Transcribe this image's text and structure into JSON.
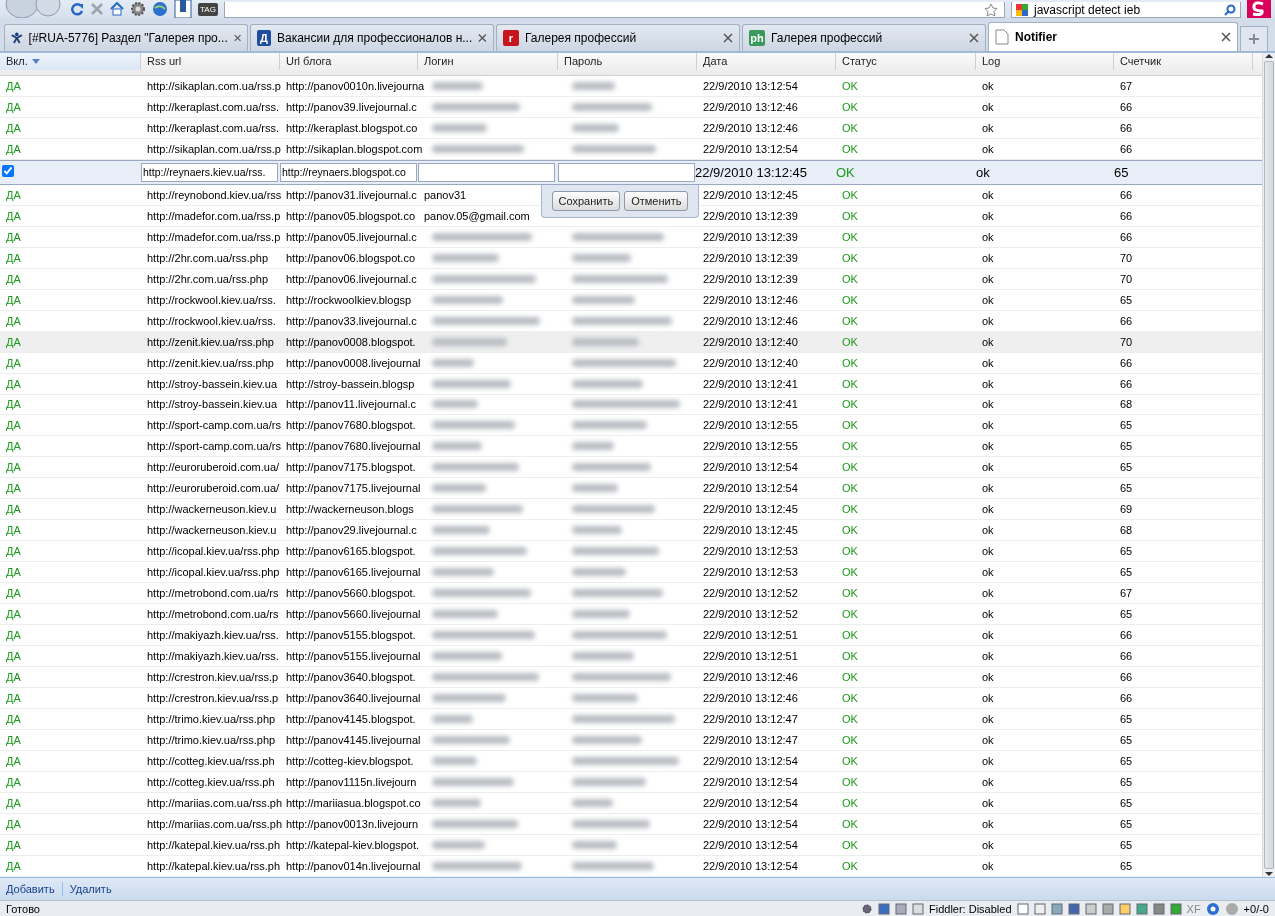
{
  "browser": {
    "search_query": "javascript detect ieb",
    "tag_label": "TAG"
  },
  "tabs": [
    {
      "label": "[#RUA-5776] Раздел \"Галерея про...",
      "selected": false,
      "kind": "figure"
    },
    {
      "label": "Вакансии для профессионалов н...",
      "selected": false,
      "kind": "letter",
      "icon_text": "Д"
    },
    {
      "label": "Галерея профессий",
      "selected": false,
      "kind": "letter",
      "icon_text": "r"
    },
    {
      "label": "Галерея профессий",
      "selected": false,
      "kind": "letter",
      "icon_text": "ph"
    },
    {
      "label": "Notifier",
      "selected": true,
      "kind": "page"
    }
  ],
  "grid": {
    "columns": [
      {
        "label": "Вкл.",
        "sorted": true
      },
      {
        "label": "Rss url",
        "sorted": false
      },
      {
        "label": "Url блога",
        "sorted": false
      },
      {
        "label": "Логин",
        "sorted": false
      },
      {
        "label": "Пароль",
        "sorted": false
      },
      {
        "label": "Дата",
        "sorted": false
      },
      {
        "label": "Статус",
        "sorted": false
      },
      {
        "label": "Log",
        "sorted": false
      },
      {
        "label": "Счетчик",
        "sorted": false
      }
    ],
    "rows": [
      {
        "kind": "view",
        "on": "ДА",
        "rss": "http://sikaplan.com.ua/rss.p",
        "blog": "http://panov0010n.livejourna",
        "login_blurred": true,
        "password_blurred": true,
        "date": "22/9/2010 13:12:54",
        "status": "OK",
        "log": "ok",
        "count": "67",
        "highlighted": false
      },
      {
        "kind": "view",
        "on": "ДА",
        "rss": "http://keraplast.com.ua/rss.",
        "blog": "http://panov39.livejournal.c",
        "login_blurred": true,
        "password_blurred": true,
        "date": "22/9/2010 13:12:46",
        "status": "OK",
        "log": "ok",
        "count": "66",
        "highlighted": false
      },
      {
        "kind": "view",
        "on": "ДА",
        "rss": "http://keraplast.com.ua/rss.",
        "blog": "http://keraplast.blogspot.co",
        "login_blurred": true,
        "password_blurred": true,
        "date": "22/9/2010 13:12:46",
        "status": "OK",
        "log": "ok",
        "count": "66",
        "highlighted": false
      },
      {
        "kind": "view",
        "on": "ДА",
        "rss": "http://sikaplan.com.ua/rss.p",
        "blog": "http://sikaplan.blogspot.com",
        "login_blurred": true,
        "password_blurred": true,
        "date": "22/9/2010 13:12:54",
        "status": "OK",
        "log": "ok",
        "count": "66",
        "highlighted": false
      },
      {
        "kind": "editor",
        "checked": true,
        "rss": "http://reynaers.kiev.ua/rss.",
        "blog": "http://reynaers.blogspot.co",
        "date": "22/9/2010 13:12:45",
        "status": "OK",
        "log": "ok",
        "count": "65"
      },
      {
        "kind": "view",
        "on": "ДА",
        "rss": "http://reynobond.kiev.ua/rss",
        "blog": "http://panov31.livejournal.c",
        "login": "panov31",
        "date": "22/9/2010 13:12:45",
        "status": "OK",
        "log": "ok",
        "count": "66",
        "highlighted": false
      },
      {
        "kind": "view",
        "on": "ДА",
        "rss": "http://madefor.com.ua/rss.p",
        "blog": "http://panov05.blogspot.co",
        "login": "panov.05@gmail.com",
        "date": "22/9/2010 13:12:39",
        "status": "OK",
        "log": "ok",
        "count": "66",
        "highlighted": false
      },
      {
        "kind": "view",
        "on": "ДА",
        "rss": "http://madefor.com.ua/rss.p",
        "blog": "http://panov05.livejournal.c",
        "login_blurred": true,
        "password_blurred": true,
        "date": "22/9/2010 13:12:39",
        "status": "OK",
        "log": "ok",
        "count": "66",
        "highlighted": false
      },
      {
        "kind": "view",
        "on": "ДА",
        "rss": "http://2hr.com.ua/rss.php",
        "blog": "http://panov06.blogspot.co",
        "login_blurred": true,
        "password_blurred": true,
        "date": "22/9/2010 13:12:39",
        "status": "OK",
        "log": "ok",
        "count": "70",
        "highlighted": false
      },
      {
        "kind": "view",
        "on": "ДА",
        "rss": "http://2hr.com.ua/rss.php",
        "blog": "http://panov06.livejournal.c",
        "login_blurred": true,
        "password_blurred": true,
        "date": "22/9/2010 13:12:39",
        "status": "OK",
        "log": "ok",
        "count": "70",
        "highlighted": false
      },
      {
        "kind": "view",
        "on": "ДА",
        "rss": "http://rockwool.kiev.ua/rss.",
        "blog": "http://rockwoolkiev.blogsp",
        "login_blurred": true,
        "password_blurred": true,
        "date": "22/9/2010 13:12:46",
        "status": "OK",
        "log": "ok",
        "count": "65",
        "highlighted": false
      },
      {
        "kind": "view",
        "on": "ДА",
        "rss": "http://rockwool.kiev.ua/rss.",
        "blog": "http://panov33.livejournal.c",
        "login_blurred": true,
        "password_blurred": true,
        "date": "22/9/2010 13:12:46",
        "status": "OK",
        "log": "ok",
        "count": "66",
        "highlighted": false
      },
      {
        "kind": "view",
        "on": "ДА",
        "rss": "http://zenit.kiev.ua/rss.php",
        "blog": "http://panov0008.blogspot.",
        "login_blurred": true,
        "password_blurred": true,
        "date": "22/9/2010 13:12:40",
        "status": "OK",
        "log": "ok",
        "count": "70",
        "highlighted": true
      },
      {
        "kind": "view",
        "on": "ДА",
        "rss": "http://zenit.kiev.ua/rss.php",
        "blog": "http://panov0008.livejournal",
        "login_blurred": true,
        "password_blurred": true,
        "date": "22/9/2010 13:12:40",
        "status": "OK",
        "log": "ok",
        "count": "66",
        "highlighted": false
      },
      {
        "kind": "view",
        "on": "ДА",
        "rss": "http://stroy-bassein.kiev.ua",
        "blog": "http://stroy-bassein.blogsp",
        "login_blurred": true,
        "password_blurred": true,
        "date": "22/9/2010 13:12:41",
        "status": "OK",
        "log": "ok",
        "count": "66",
        "highlighted": false
      },
      {
        "kind": "view",
        "on": "ДА",
        "rss": "http://stroy-bassein.kiev.ua",
        "blog": "http://panov11.livejournal.c",
        "login_blurred": true,
        "password_blurred": true,
        "date": "22/9/2010 13:12:41",
        "status": "OK",
        "log": "ok",
        "count": "68",
        "highlighted": false
      },
      {
        "kind": "view",
        "on": "ДА",
        "rss": "http://sport-camp.com.ua/rs",
        "blog": "http://panov7680.blogspot.",
        "login_blurred": true,
        "password_blurred": true,
        "date": "22/9/2010 13:12:55",
        "status": "OK",
        "log": "ok",
        "count": "65",
        "highlighted": false
      },
      {
        "kind": "view",
        "on": "ДА",
        "rss": "http://sport-camp.com.ua/rs",
        "blog": "http://panov7680.livejournal",
        "login_blurred": true,
        "password_blurred": true,
        "date": "22/9/2010 13:12:55",
        "status": "OK",
        "log": "ok",
        "count": "65",
        "highlighted": false
      },
      {
        "kind": "view",
        "on": "ДА",
        "rss": "http://euroruberoid.com.ua/",
        "blog": "http://panov7175.blogspot.",
        "login_blurred": true,
        "password_blurred": true,
        "date": "22/9/2010 13:12:54",
        "status": "OK",
        "log": "ok",
        "count": "65",
        "highlighted": false
      },
      {
        "kind": "view",
        "on": "ДА",
        "rss": "http://euroruberoid.com.ua/",
        "blog": "http://panov7175.livejournal",
        "login_blurred": true,
        "password_blurred": true,
        "date": "22/9/2010 13:12:54",
        "status": "OK",
        "log": "ok",
        "count": "65",
        "highlighted": false
      },
      {
        "kind": "view",
        "on": "ДА",
        "rss": "http://wackerneuson.kiev.u",
        "blog": "http://wackerneuson.blogs",
        "login_blurred": true,
        "password_blurred": true,
        "date": "22/9/2010 13:12:45",
        "status": "OK",
        "log": "ok",
        "count": "69",
        "highlighted": false
      },
      {
        "kind": "view",
        "on": "ДА",
        "rss": "http://wackerneuson.kiev.u",
        "blog": "http://panov29.livejournal.c",
        "login_blurred": true,
        "password_blurred": true,
        "date": "22/9/2010 13:12:45",
        "status": "OK",
        "log": "ok",
        "count": "68",
        "highlighted": false
      },
      {
        "kind": "view",
        "on": "ДА",
        "rss": "http://icopal.kiev.ua/rss.php",
        "blog": "http://panov6165.blogspot.",
        "login_blurred": true,
        "password_blurred": true,
        "date": "22/9/2010 13:12:53",
        "status": "OK",
        "log": "ok",
        "count": "65",
        "highlighted": false
      },
      {
        "kind": "view",
        "on": "ДА",
        "rss": "http://icopal.kiev.ua/rss.php",
        "blog": "http://panov6165.livejournal",
        "login_blurred": true,
        "password_blurred": true,
        "date": "22/9/2010 13:12:53",
        "status": "OK",
        "log": "ok",
        "count": "65",
        "highlighted": false
      },
      {
        "kind": "view",
        "on": "ДА",
        "rss": "http://metrobond.com.ua/rs",
        "blog": "http://panov5660.blogspot.",
        "login_blurred": true,
        "password_blurred": true,
        "date": "22/9/2010 13:12:52",
        "status": "OK",
        "log": "ok",
        "count": "67",
        "highlighted": false
      },
      {
        "kind": "view",
        "on": "ДА",
        "rss": "http://metrobond.com.ua/rs",
        "blog": "http://panov5660.livejournal",
        "login_blurred": true,
        "password_blurred": true,
        "date": "22/9/2010 13:12:52",
        "status": "OK",
        "log": "ok",
        "count": "65",
        "highlighted": false
      },
      {
        "kind": "view",
        "on": "ДА",
        "rss": "http://makiyazh.kiev.ua/rss.",
        "blog": "http://panov5155.blogspot.",
        "login_blurred": true,
        "password_blurred": true,
        "date": "22/9/2010 13:12:51",
        "status": "OK",
        "log": "ok",
        "count": "66",
        "highlighted": false
      },
      {
        "kind": "view",
        "on": "ДА",
        "rss": "http://makiyazh.kiev.ua/rss.",
        "blog": "http://panov5155.livejournal",
        "login_blurred": true,
        "password_blurred": true,
        "date": "22/9/2010 13:12:51",
        "status": "OK",
        "log": "ok",
        "count": "66",
        "highlighted": false
      },
      {
        "kind": "view",
        "on": "ДА",
        "rss": "http://crestron.kiev.ua/rss.p",
        "blog": "http://panov3640.blogspot.",
        "login_blurred": true,
        "password_blurred": true,
        "date": "22/9/2010 13:12:46",
        "status": "OK",
        "log": "ok",
        "count": "66",
        "highlighted": false
      },
      {
        "kind": "view",
        "on": "ДА",
        "rss": "http://crestron.kiev.ua/rss.p",
        "blog": "http://panov3640.livejournal",
        "login_blurred": true,
        "password_blurred": true,
        "date": "22/9/2010 13:12:46",
        "status": "OK",
        "log": "ok",
        "count": "66",
        "highlighted": false
      },
      {
        "kind": "view",
        "on": "ДА",
        "rss": "http://trimo.kiev.ua/rss.php",
        "blog": "http://panov4145.blogspot.",
        "login_blurred": true,
        "password_blurred": true,
        "date": "22/9/2010 13:12:47",
        "status": "OK",
        "log": "ok",
        "count": "65",
        "highlighted": false
      },
      {
        "kind": "view",
        "on": "ДА",
        "rss": "http://trimo.kiev.ua/rss.php",
        "blog": "http://panov4145.livejournal",
        "login_blurred": true,
        "password_blurred": true,
        "date": "22/9/2010 13:12:47",
        "status": "OK",
        "log": "ok",
        "count": "65",
        "highlighted": false
      },
      {
        "kind": "view",
        "on": "ДА",
        "rss": "http://cotteg.kiev.ua/rss.ph",
        "blog": "http://cotteg-kiev.blogspot.",
        "login_blurred": true,
        "password_blurred": true,
        "date": "22/9/2010 13:12:54",
        "status": "OK",
        "log": "ok",
        "count": "65",
        "highlighted": false
      },
      {
        "kind": "view",
        "on": "ДА",
        "rss": "http://cotteg.kiev.ua/rss.ph",
        "blog": "http://panov1115n.livejourn",
        "login_blurred": true,
        "password_blurred": true,
        "date": "22/9/2010 13:12:54",
        "status": "OK",
        "log": "ok",
        "count": "65",
        "highlighted": false
      },
      {
        "kind": "view",
        "on": "ДА",
        "rss": "http://mariias.com.ua/rss.ph",
        "blog": "http://mariiasua.blogspot.co",
        "login_blurred": true,
        "password_blurred": true,
        "date": "22/9/2010 13:12:54",
        "status": "OK",
        "log": "ok",
        "count": "65",
        "highlighted": false
      },
      {
        "kind": "view",
        "on": "ДА",
        "rss": "http://mariias.com.ua/rss.ph",
        "blog": "http://panov0013n.livejourn",
        "login_blurred": true,
        "password_blurred": true,
        "date": "22/9/2010 13:12:54",
        "status": "OK",
        "log": "ok",
        "count": "65",
        "highlighted": false
      },
      {
        "kind": "view",
        "on": "ДА",
        "rss": "http://katepal.kiev.ua/rss.ph",
        "blog": "http://katepal-kiev.blogspot.",
        "login_blurred": true,
        "password_blurred": true,
        "date": "22/9/2010 13:12:54",
        "status": "OK",
        "log": "ok",
        "count": "65",
        "highlighted": false
      },
      {
        "kind": "view",
        "on": "ДА",
        "rss": "http://katepal.kiev.ua/rss.ph",
        "blog": "http://panov014n.livejournal",
        "login_blurred": true,
        "password_blurred": true,
        "date": "22/9/2010 13:12:54",
        "status": "OK",
        "log": "ok",
        "count": "65",
        "highlighted": false
      }
    ],
    "editor_buttons": [
      "Сохранить",
      "Отменить"
    ]
  },
  "footer_buttons": [
    "Добавить",
    "Удалить"
  ],
  "status_bar": {
    "text": "Готово",
    "fiddler": "Fiddler: Disabled",
    "xf": "XF",
    "counter": "+0/-0"
  }
}
